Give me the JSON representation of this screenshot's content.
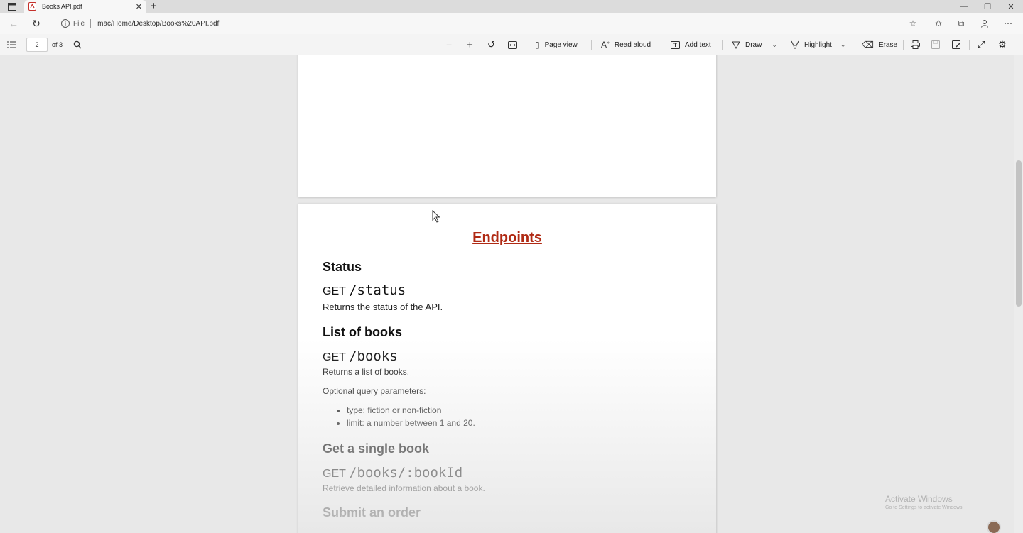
{
  "browser": {
    "tab_title": "Books API.pdf",
    "new_tab_symbol": "+",
    "address": {
      "scheme_label": "File",
      "url": "mac/Home/Desktop/Books%20API.pdf"
    }
  },
  "pdf_toolbar": {
    "page_number": "2",
    "page_total": "of 3",
    "page_view_label": "Page view",
    "read_aloud_label": "Read aloud",
    "add_text_label": "Add text",
    "draw_label": "Draw",
    "highlight_label": "Highlight",
    "erase_label": "Erase"
  },
  "document": {
    "title": "Endpoints",
    "sections": [
      {
        "heading": "Status",
        "method": "GET",
        "path": "/status",
        "description": "Returns the status of the API."
      },
      {
        "heading": "List of books",
        "method": "GET",
        "path": "/books",
        "description": "Returns a list of books.",
        "note": "Optional query parameters:",
        "bullets": [
          "type: fiction or non-fiction",
          "limit: a number between 1 and 20."
        ]
      },
      {
        "heading": "Get a single book",
        "method": "GET",
        "path": "/books/:bookId",
        "description": "Retrieve detailed information about a book."
      },
      {
        "heading": "Submit an order"
      }
    ]
  },
  "watermark": {
    "line1": "Activate Windows",
    "line2": "Go to Settings to activate Windows."
  },
  "colors": {
    "title_red": "#b02a14",
    "viewer_bg": "#e8e8e8"
  }
}
